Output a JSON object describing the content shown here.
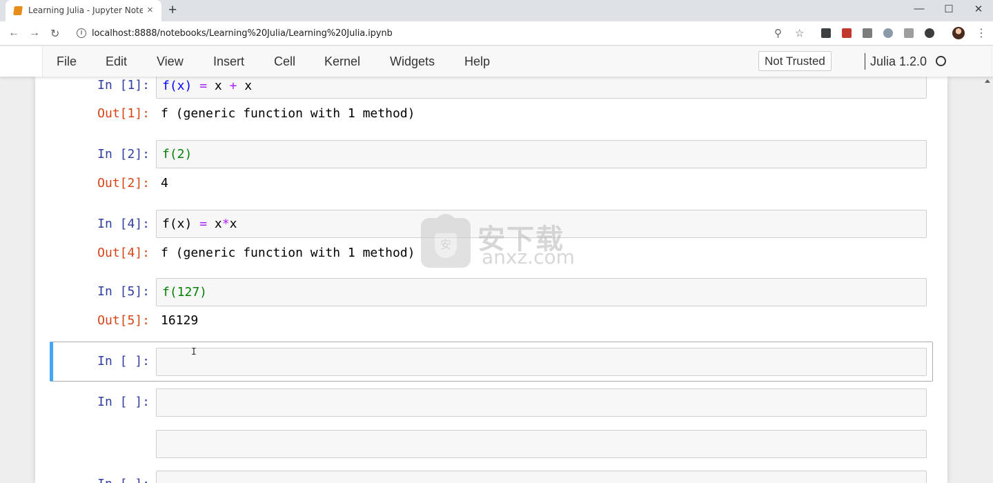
{
  "browser": {
    "tab_title": "Learning Julia - Jupyter Noteboo",
    "tab_close": "×",
    "new_tab": "+",
    "url": "localhost:8888/notebooks/Learning%20Julia/Learning%20Julia.ipynb",
    "window_controls": {
      "minimize": "—",
      "maximize": "☐",
      "close": "✕"
    }
  },
  "menubar": {
    "items": [
      "File",
      "Edit",
      "View",
      "Insert",
      "Cell",
      "Kernel",
      "Widgets",
      "Help"
    ],
    "trust_status": "Not Trusted",
    "kernel": "Julia 1.2.0"
  },
  "cells": [
    {
      "in_prompt": "In [1]:",
      "code_a": "f(x) ",
      "code_op1": "=",
      "code_b": " x ",
      "code_op2": "+",
      "code_c": " x",
      "out_prompt": "Out[1]:",
      "output": "f (generic function with 1 method)"
    },
    {
      "in_prompt": "In [2]:",
      "code": "f(2)",
      "out_prompt": "Out[2]:",
      "output": "4"
    },
    {
      "in_prompt": "In [4]:",
      "code_a": "f(x) ",
      "code_op1": "=",
      "code_b": " x",
      "code_op2": "*",
      "code_c": "x",
      "out_prompt": "Out[4]:",
      "output": "f (generic function with 1 method)"
    },
    {
      "in_prompt": "In [5]:",
      "code": "f(127)",
      "out_prompt": "Out[5]:",
      "output": "16129"
    },
    {
      "in_prompt": "In [ ]:",
      "code": ""
    },
    {
      "in_prompt": "In [ ]:",
      "code": ""
    },
    {
      "in_prompt": "",
      "code": ""
    },
    {
      "in_prompt": "In [ ]:",
      "code": ""
    }
  ],
  "watermark": {
    "cn": "安下载",
    "en": "anxz.com",
    "shield": "安"
  },
  "colors": {
    "in_prompt": "#303f9f",
    "out_prompt": "#d84315",
    "selected_border": "#42a5f5",
    "operator": "#aa22ff",
    "number": "#008000"
  }
}
